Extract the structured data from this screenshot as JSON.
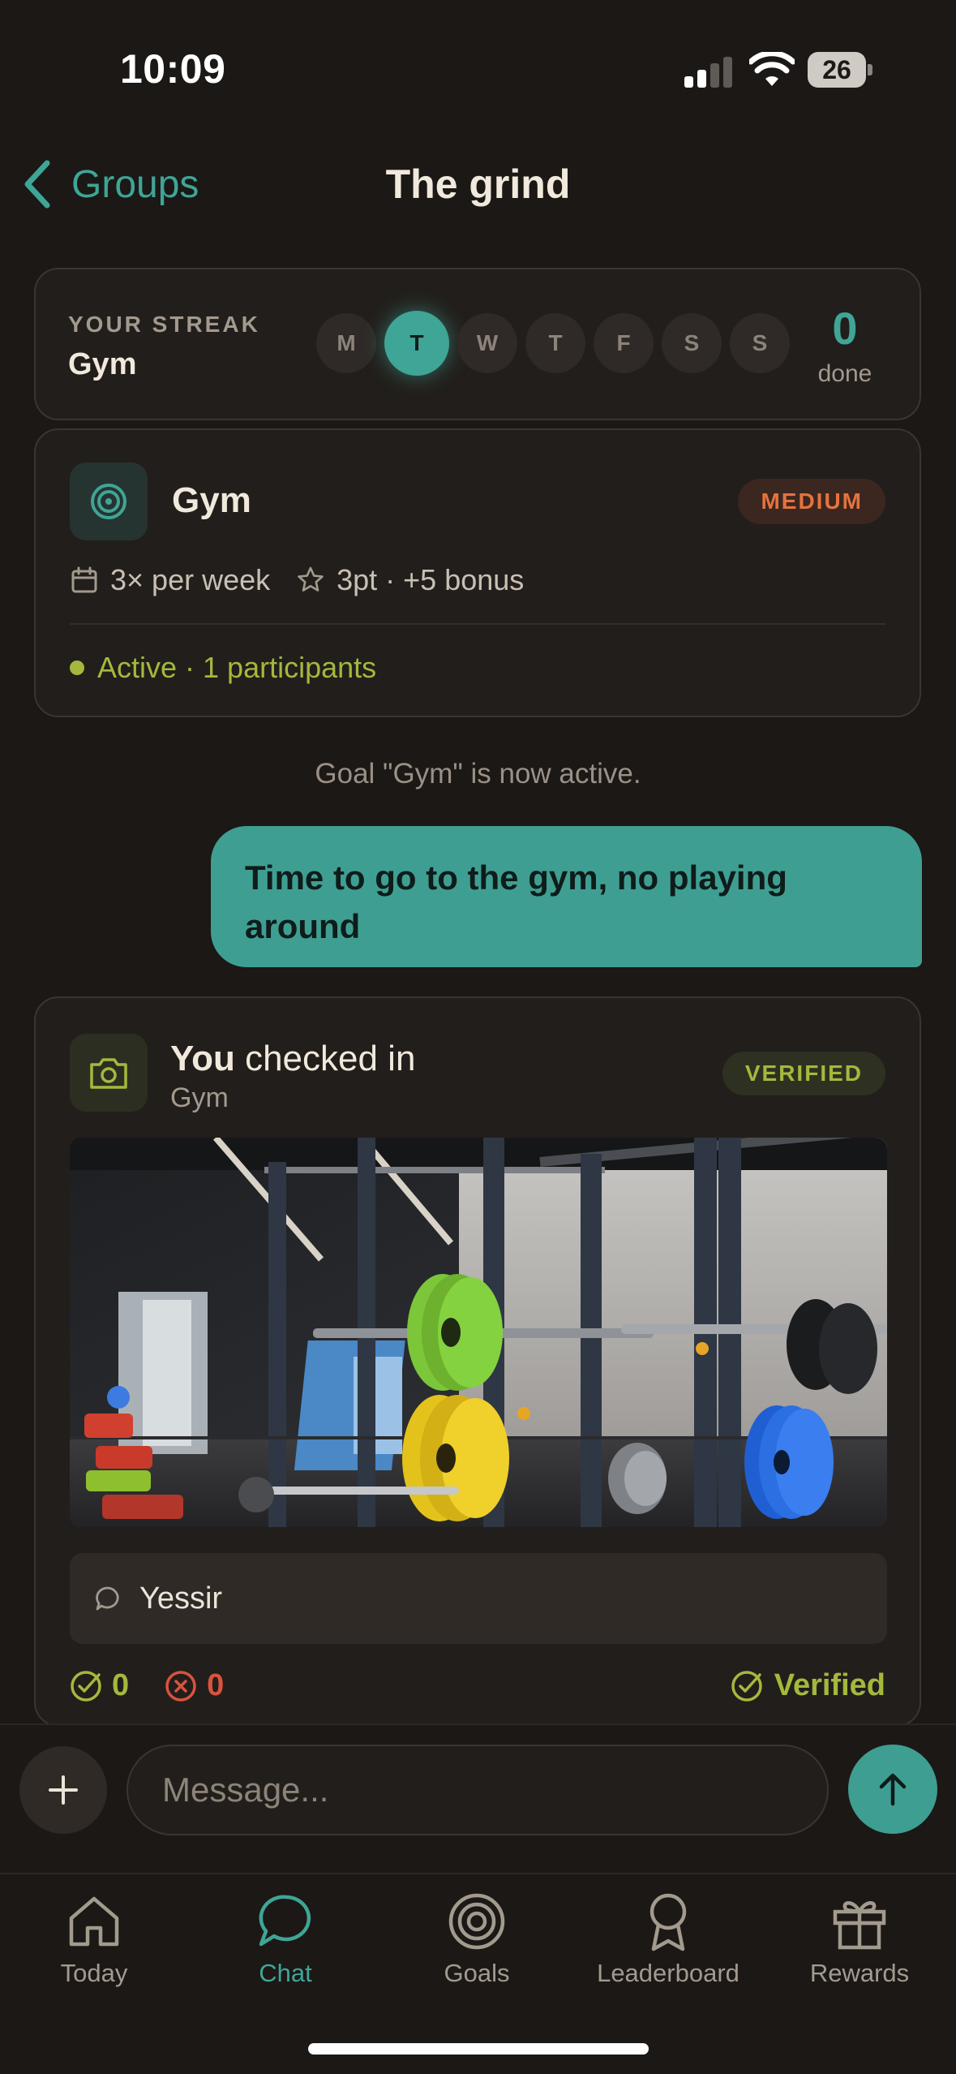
{
  "status_bar": {
    "time": "10:09",
    "battery": "26"
  },
  "header": {
    "back_label": "Groups",
    "title": "The grind"
  },
  "streak": {
    "label": "YOUR STREAK",
    "goal": "Gym",
    "days": [
      "M",
      "T",
      "W",
      "T",
      "F",
      "S",
      "S"
    ],
    "active_day_index": 1,
    "done_count": "0",
    "done_label": "done"
  },
  "goal_card": {
    "name": "Gym",
    "difficulty": "MEDIUM",
    "frequency": "3× per week",
    "points": "3pt · +5 bonus",
    "status": "Active · 1 participants"
  },
  "system_message": "Goal \"Gym\" is now active.",
  "outgoing_message": "Time to go to the gym, no playing around",
  "checkin": {
    "title_you": "You",
    "title_rest": "checked in",
    "goal": "Gym",
    "badge": "VERIFIED",
    "caption": "Yessir",
    "approve_count": "0",
    "reject_count": "0",
    "status": "Verified"
  },
  "composer": {
    "placeholder": "Message..."
  },
  "tabs": [
    {
      "label": "Today",
      "icon": "home-icon"
    },
    {
      "label": "Chat",
      "icon": "chat-bubble-icon"
    },
    {
      "label": "Goals",
      "icon": "target-icon"
    },
    {
      "label": "Leaderboard",
      "icon": "medal-icon"
    },
    {
      "label": "Rewards",
      "icon": "gift-icon"
    }
  ],
  "active_tab": "Chat",
  "colors": {
    "accent": "#3fa596",
    "background": "#1b1816",
    "card": "#221e1b",
    "success": "#a5b83d",
    "danger": "#d9533f",
    "difficulty": "#e4733e"
  }
}
